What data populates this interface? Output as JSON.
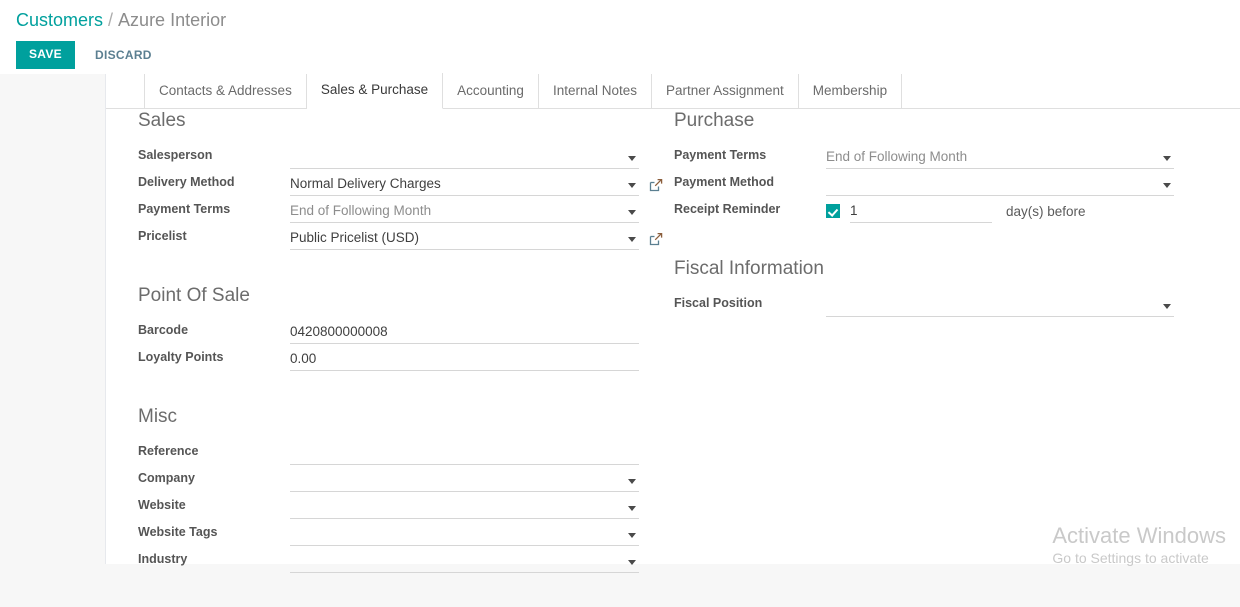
{
  "breadcrumb": {
    "root": "Customers",
    "separator": "/",
    "current": "Azure Interior"
  },
  "actions": {
    "save_label": "SAVE",
    "discard_label": "DISCARD"
  },
  "notebook": {
    "tabs": [
      {
        "label": "Contacts & Addresses",
        "active": false
      },
      {
        "label": "Sales & Purchase",
        "active": true
      },
      {
        "label": "Accounting",
        "active": false
      },
      {
        "label": "Internal Notes",
        "active": false
      },
      {
        "label": "Partner Assignment",
        "active": false
      },
      {
        "label": "Membership",
        "active": false
      }
    ]
  },
  "groups": {
    "sales": {
      "title": "Sales",
      "fields": {
        "salesperson": {
          "label": "Salesperson",
          "value": ""
        },
        "delivery_method": {
          "label": "Delivery Method",
          "value": "Normal Delivery Charges"
        },
        "payment_terms": {
          "label": "Payment Terms",
          "value": "End of Following Month"
        },
        "pricelist": {
          "label": "Pricelist",
          "value": "Public Pricelist (USD)"
        }
      }
    },
    "purchase": {
      "title": "Purchase",
      "fields": {
        "payment_terms": {
          "label": "Payment Terms",
          "value": "End of Following Month"
        },
        "payment_method": {
          "label": "Payment Method",
          "value": ""
        },
        "receipt_reminder": {
          "label": "Receipt Reminder",
          "checked": true,
          "days": "1",
          "suffix": "day(s) before"
        }
      }
    },
    "point_of_sale": {
      "title": "Point Of Sale",
      "fields": {
        "barcode": {
          "label": "Barcode",
          "value": "0420800000008"
        },
        "loyalty_points": {
          "label": "Loyalty Points",
          "value": "0.00"
        }
      }
    },
    "fiscal_information": {
      "title": "Fiscal Information",
      "fields": {
        "fiscal_position": {
          "label": "Fiscal Position",
          "value": ""
        }
      }
    },
    "misc": {
      "title": "Misc",
      "fields": {
        "reference": {
          "label": "Reference",
          "value": ""
        },
        "company": {
          "label": "Company",
          "value": ""
        },
        "website": {
          "label": "Website",
          "value": ""
        },
        "website_tags": {
          "label": "Website Tags",
          "value": ""
        },
        "industry": {
          "label": "Industry",
          "value": ""
        }
      }
    }
  },
  "watermark": {
    "title": "Activate Windows",
    "subtitle": "Go to Settings to activate"
  },
  "colors": {
    "accent": "#00a09d",
    "link": "#00a09d",
    "discard_text": "#5b7f91",
    "label_text": "#555555",
    "value_text": "#3f3f3f",
    "muted_text": "#8d8d8d",
    "underline": "#d6d6d6",
    "ext_link_icon": "#5b7f91"
  }
}
